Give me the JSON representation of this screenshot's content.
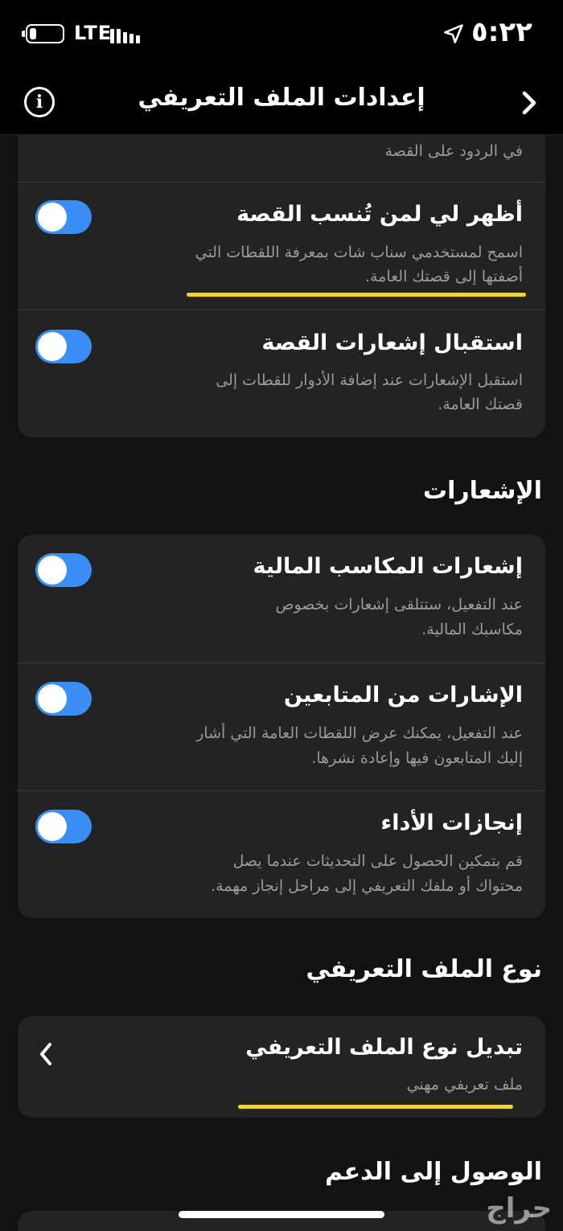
{
  "status_bar": {
    "network": "LTE",
    "time": "٥:٢٢",
    "battery_icon": "battery-low-icon",
    "signal_icon": "signal-bars-icon",
    "location_icon": "location-arrow-icon"
  },
  "nav": {
    "title": "إعدادات الملف التعريفي",
    "info_icon": "info-icon",
    "back_icon": "chevron-right-icon"
  },
  "story_card": {
    "partial_text": "في الردود على القصة",
    "rows": [
      {
        "title": "أظهر لي لمن تُنسب القصة",
        "desc_line1": "اسمح لمستخدمي سناب شات بمعرفة اللقطات التي",
        "desc_line2": "أضفتها إلى قصتك العامة.",
        "toggle_on": true
      },
      {
        "title": "استقبال إشعارات القصة",
        "desc_line1": "استقبل الإشعارات عند إضافة الأدوار للقطات إلى",
        "desc_line2": "قصتك العامة.",
        "toggle_on": true
      }
    ]
  },
  "notifications_section": {
    "header": "الإشعارات",
    "rows": [
      {
        "title": "إشعارات المكاسب المالية",
        "desc_line1": "عند التفعيل، ستتلقى إشعارات بخصوص",
        "desc_line2": "مكاسبك المالية.",
        "toggle_on": true
      },
      {
        "title": "الإشارات من المتابعين",
        "desc_line1": "عند التفعيل، يمكنك عرض اللقطات العامة التي أشار",
        "desc_line2": "إليك المتابعون فيها وإعادة نشرها.",
        "toggle_on": true
      },
      {
        "title": "إنجازات الأداء",
        "desc_line1": "قم بتمكين الحصول على التحديثات عندما يصل",
        "desc_line2": "محتواك أو ملفك التعريفي إلى مراحل إنجاز مهمة.",
        "toggle_on": true
      }
    ]
  },
  "profile_type_section": {
    "header": "نوع الملف التعريفي",
    "row": {
      "title": "تبديل نوع الملف التعريفي",
      "value": "ملف تعريفي مهني",
      "chevron_icon": "chevron-left-icon"
    }
  },
  "support_section": {
    "header": "الوصول إلى الدعم"
  },
  "highlight_color": "#f5d81c",
  "toggle_color": "#3a8ef6",
  "watermark": "حراج"
}
